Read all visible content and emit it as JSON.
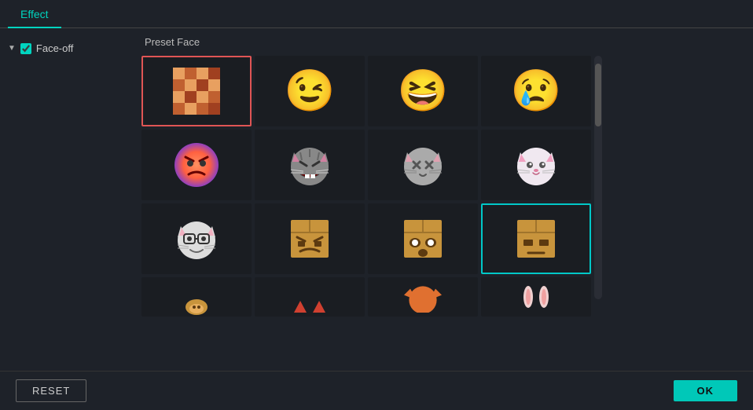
{
  "tabs": [
    {
      "label": "Effect",
      "active": true
    }
  ],
  "sidebar": {
    "items": [
      {
        "id": "face-off",
        "label": "Face-off",
        "checked": true,
        "expanded": true
      }
    ]
  },
  "preset": {
    "title": "Preset Face",
    "grid": [
      [
        {
          "id": "mosaic",
          "emoji": "mosaic",
          "selected": "red"
        },
        {
          "id": "wink",
          "emoji": "😉",
          "selected": null
        },
        {
          "id": "laugh",
          "emoji": "😆",
          "selected": null
        },
        {
          "id": "cry",
          "emoji": "😢",
          "selected": null
        }
      ],
      [
        {
          "id": "angry-face",
          "emoji": "😤",
          "selected": null
        },
        {
          "id": "angry-cat",
          "emoji": "😾",
          "selected": null
        },
        {
          "id": "grey-cat",
          "emoji": "🐱",
          "selected": null
        },
        {
          "id": "pink-cat",
          "emoji": "🐱",
          "selected": null
        }
      ],
      [
        {
          "id": "cartoon-cat",
          "emoji": "😸",
          "selected": null
        },
        {
          "id": "box1",
          "emoji": "📦",
          "selected": null
        },
        {
          "id": "box2",
          "emoji": "📦",
          "selected": null
        },
        {
          "id": "box3",
          "emoji": "📦",
          "selected": "cyan"
        }
      ]
    ],
    "partial_row": [
      {
        "id": "bear",
        "emoji": "🐻",
        "partial": true
      },
      {
        "id": "devil",
        "emoji": "😈",
        "partial": true
      },
      {
        "id": "fox",
        "emoji": "🦊",
        "partial": true
      },
      {
        "id": "ears",
        "emoji": "🐰",
        "partial": true
      }
    ]
  },
  "buttons": {
    "reset": "RESET",
    "ok": "OK"
  },
  "colors": {
    "accent_cyan": "#00c8b8",
    "selected_red": "#e05555",
    "selected_cyan": "#00c8c8",
    "bg_dark": "#1a1d22",
    "bg_main": "#1e2229"
  }
}
